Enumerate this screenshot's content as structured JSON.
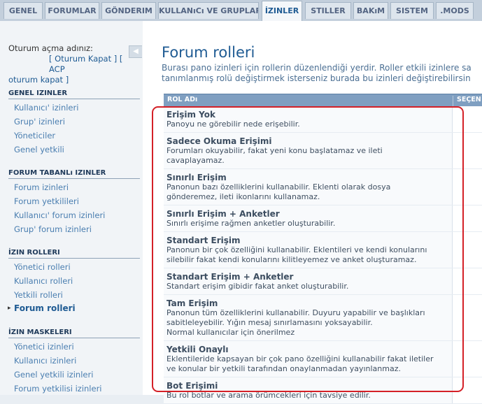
{
  "tabs": [
    {
      "label": "GENEL",
      "active": false
    },
    {
      "label": "FORUMLAR",
      "active": false
    },
    {
      "label": "GÖNDERIM",
      "active": false
    },
    {
      "label": "KULLANıCı VE GRUPLAR",
      "active": false
    },
    {
      "label": "İZINLER",
      "active": true
    },
    {
      "label": "STILLER",
      "active": false
    },
    {
      "label": "BAKıM",
      "active": false
    },
    {
      "label": "SISTEM",
      "active": false
    },
    {
      "label": ".MODS",
      "active": false
    }
  ],
  "login": {
    "prefix": "Oturum açma adınız:",
    "logout_label": "[ Oturum Kapat ]",
    "acp_label": "[ ACP",
    "acp_logout_label": "oturum kapat ]"
  },
  "sidebar": {
    "sections": [
      {
        "title": "GENEL IZINLER",
        "items": [
          "Kullanıcı' izinleri",
          "Grup' izinleri",
          "Yöneticiler",
          "Genel yetkili"
        ]
      },
      {
        "title": "FORUM TABANLı IZINLER",
        "items": [
          "Forum izinleri",
          "Forum yetkilileri",
          "Kullanıcı' forum izinleri",
          "Grup' forum izinleri"
        ]
      },
      {
        "title": "İZIN ROLLERI",
        "items": [
          "Yönetici rolleri",
          "Kullanıcı rolleri",
          "Yetkili rolleri",
          "Forum rolleri"
        ]
      },
      {
        "title": "İZIN MASKELERI",
        "items": [
          "Yönetici izinleri",
          "Kullanıcı izinleri",
          "Genel yetkili izinleri",
          "Forum yetkilisi izinleri"
        ]
      }
    ],
    "active_item": "Forum rolleri"
  },
  "main": {
    "title": "Forum rolleri",
    "description_line1": "Burası pano izinleri için rollerin düzenlendiği yerdir. Roller etkili izinlere sa",
    "description_line2": "tanımlanmış rolü değiştirmek isterseniz burada bu izinleri değiştirebilirsin",
    "table": {
      "col_role": "ROL ADı",
      "col_select": "SEÇEN",
      "rows": [
        {
          "name": "Erişim Yok",
          "desc": [
            "Panoyu ne görebilir nede erişebilir."
          ]
        },
        {
          "name": "Sadece Okuma Erişimi",
          "desc": [
            "Forumları okuyabilir, fakat yeni konu başlatamaz ve ileti",
            "cavaplayamaz."
          ]
        },
        {
          "name": "Sınırlı Erişim",
          "desc": [
            "Panonun bazı özelliklerini kullanabilir. Eklenti olarak dosya",
            "gönderemez, ileti ikonlarını kullanamaz."
          ]
        },
        {
          "name": "Sınırlı Erişim + Anketler",
          "desc": [
            "Sınırlı erişime rağmen anketler oluşturabilir."
          ]
        },
        {
          "name": "Standart Erişim",
          "desc": [
            "Panonun bir çok özelliğini kullanabilir. Eklentileri ve kendi konularını",
            "silebilir fakat kendi konularını kilitleyemez ve anket oluşturamaz."
          ]
        },
        {
          "name": "Standart Erişim + Anketler",
          "desc": [
            "Standart erişim gibidir fakat anket oluşturabilir."
          ]
        },
        {
          "name": "Tam Erişim",
          "desc": [
            "Panonun tüm özelliklerini kullanabilir. Duyuru yapabilir ve başlıkları",
            "sabitleleyebilir. Yığın mesaj sınırlamasını yoksayabilir.",
            "Normal kullanıcılar için önerilmez"
          ]
        },
        {
          "name": "Yetkili Onaylı",
          "desc": [
            "Eklentileride kapsayan bir çok pano özelliğini kullanabilir fakat iletiler",
            "ve konular bir yetkili tarafından onaylanmadan yayınlanmaz."
          ]
        },
        {
          "name": "Bot Erişimi",
          "desc": [
            "Bu rol botlar ve arama örümcekleri için tavsiye edilir."
          ]
        }
      ]
    }
  },
  "colors": {
    "accent": "#1f5b93",
    "table_header": "#7f9fc1",
    "highlight": "#d42027"
  }
}
